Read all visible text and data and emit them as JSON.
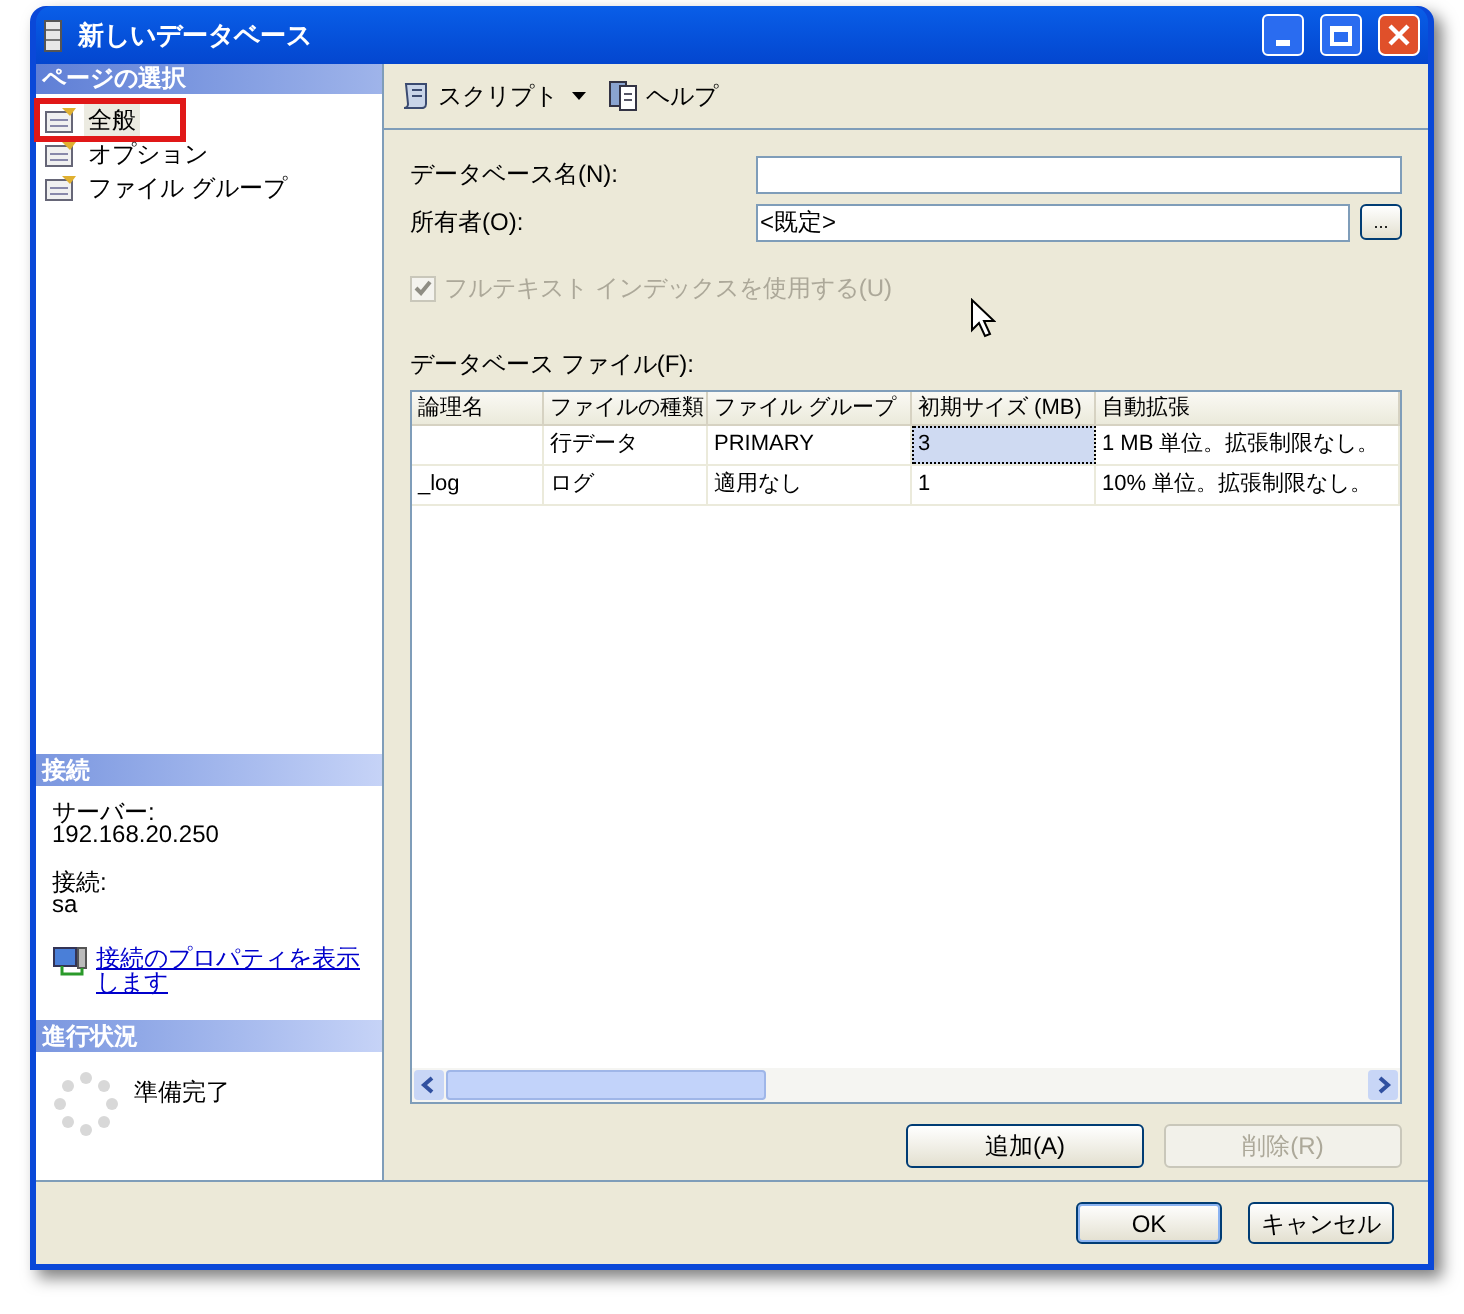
{
  "window": {
    "title": "新しいデータベース"
  },
  "sidebar": {
    "pages_header": "ページの選択",
    "pages": [
      {
        "label": "全般",
        "selected": true,
        "outlined": true
      },
      {
        "label": "オプション",
        "selected": false,
        "outlined": false
      },
      {
        "label": "ファイル グループ",
        "selected": false,
        "outlined": false
      }
    ],
    "connection": {
      "header": "接続",
      "server_label": "サーバー:",
      "server": "192.168.20.250",
      "login_label": "接続:",
      "login": "sa",
      "link": "接続のプロパティを表示します"
    },
    "progress": {
      "header": "進行状況",
      "status": "準備完了"
    }
  },
  "toolbar": [
    {
      "label": "スクリプト",
      "kind": "dropdown"
    },
    {
      "label": "ヘルプ",
      "kind": "button"
    }
  ],
  "form": {
    "name_label": "データベース名(N):",
    "owner_label": "所有者(O):",
    "owner_value": "<既定>",
    "browse": "...",
    "fulltext": {
      "label": "フルテキスト インデックスを使用する(U)",
      "checked": true,
      "disabled": true
    }
  },
  "files_label": "データベース ファイル(F):",
  "table": {
    "columns": [
      "論理名",
      "ファイルの種類",
      "ファイル グループ",
      "初期サイズ (MB)",
      "自動拡張"
    ],
    "rows": [
      {
        "cells": [
          {
            "selected": false
          },
          {
            "text": "行データ",
            "selected": false
          },
          {
            "text": "PRIMARY",
            "selected": false
          },
          {
            "text": "3",
            "selected": true
          },
          {
            "text": "1 MB 単位。拡張制限なし。",
            "selected": false
          }
        ]
      },
      {
        "cells": [
          {
            "text": "_log",
            "selected": false
          },
          {
            "text": "ログ",
            "selected": false
          },
          {
            "text": "適用なし",
            "selected": false
          },
          {
            "text": "1",
            "selected": false
          },
          {
            "text": "10% 単位。拡張制限なし。",
            "selected": false
          }
        ]
      }
    ]
  },
  "table_buttons": [
    {
      "label": "追加(A)",
      "disabled": false
    },
    {
      "label": "削除(R)",
      "disabled": true
    }
  ],
  "footer_buttons": [
    {
      "label": "OK",
      "default": true
    },
    {
      "label": "キャンセル",
      "default": false
    }
  ]
}
